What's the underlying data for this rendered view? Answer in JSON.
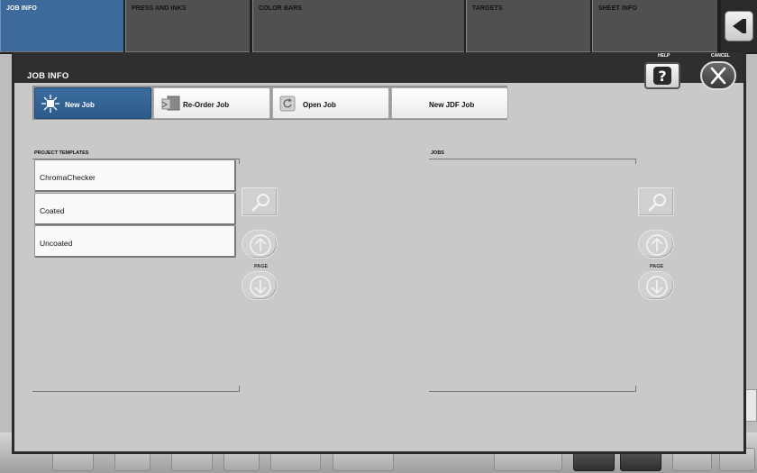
{
  "tabs": [
    {
      "label": "JOB INFO",
      "active": true
    },
    {
      "label": "PRESS AND INKS",
      "active": false
    },
    {
      "label": "COLOR BARS",
      "active": false
    },
    {
      "label": "TARGETS",
      "active": false
    },
    {
      "label": "SHEET INFO",
      "active": false
    }
  ],
  "dialog": {
    "title": "JOB INFO",
    "help_label": "HELP",
    "cancel_label": "CANCEL"
  },
  "job_buttons": {
    "new_job": "New Job",
    "reorder_job": "Re-Order Job",
    "open_job": "Open Job",
    "new_jdf_job": "New JDF Job"
  },
  "templates": {
    "header": "PROJECT TEMPLATES",
    "items": [
      "ChromaChecker",
      "Coated",
      "Uncoated"
    ],
    "page_label": "PAGE"
  },
  "jobs": {
    "header": "JOBS",
    "items": [],
    "page_label": "PAGE"
  },
  "colors": {
    "active_tab": "#3d6a9a",
    "active_button": "#2f5f8f",
    "dialog_bg": "#c9c9c9",
    "header_bg": "#2f2f2f"
  }
}
